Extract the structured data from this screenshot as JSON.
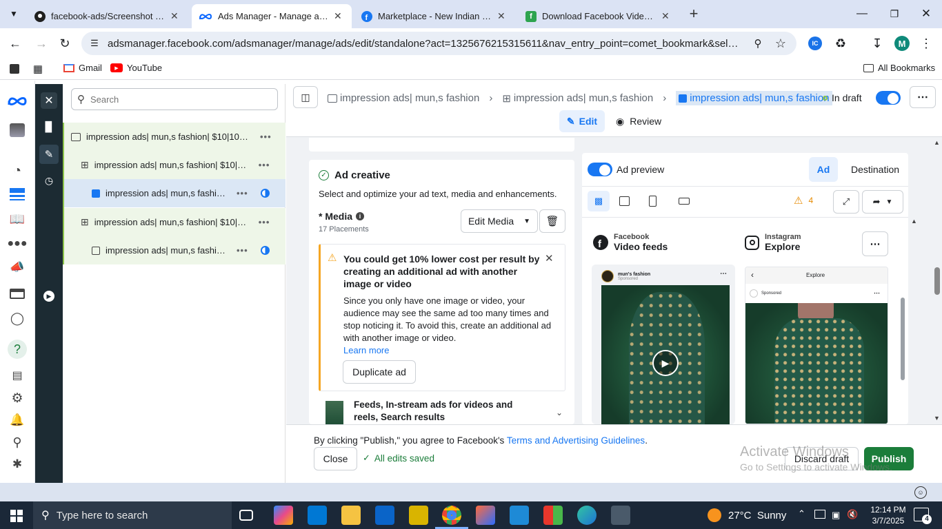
{
  "browser": {
    "tabs": [
      {
        "title": "facebook-ads/Screenshot (10).p",
        "icon": "github-icon"
      },
      {
        "title": "Ads Manager - Manage ads - A",
        "icon": "meta-icon"
      },
      {
        "title": "Marketplace - New Indian Dres",
        "icon": "facebook-icon"
      },
      {
        "title": "Download Facebook Videos On",
        "icon": "fdown-icon"
      }
    ],
    "url": "adsmanager.facebook.com/adsmanager/manage/ads/edit/standalone?act=1325676215315611&nav_entry_point=comet_bookmark&selected_cam...",
    "profile_initial": "M",
    "bookmarks": [
      "Gmail",
      "YouTube"
    ],
    "all_bookmarks": "All Bookmarks"
  },
  "search": {
    "placeholder": "Search"
  },
  "tree": {
    "items": [
      {
        "label": "impression ads| mun,s fashion| $10|10day...",
        "level": 0
      },
      {
        "label": "impression ads| mun,s fashion| $10|10...",
        "level": 1
      },
      {
        "label": "impression ads| mun,s fashion...",
        "level": 2
      },
      {
        "label": "impression ads| mun,s fashion| $10|10...",
        "level": 1
      },
      {
        "label": "impression ads| mun,s fashion...",
        "level": 2
      }
    ]
  },
  "breadcrumb": {
    "items": [
      "impression ads| mun,s fashion",
      "impression ads| mun,s fashion",
      "impression ads| mun,s fashion"
    ],
    "status": "In draft"
  },
  "mode_tabs": {
    "edit": "Edit",
    "review": "Review"
  },
  "creative": {
    "title": "Ad creative",
    "subtitle": "Select and optimize your ad text, media and enhancements.",
    "media_label": "* Media",
    "placements": "17 Placements",
    "edit_media": "Edit Media",
    "alert": {
      "title": "You could get 10% lower cost per result by creating an additional ad with another image or video",
      "body": "Since you only have one image or video, your audience may see the same ad too many times and stop noticing it. To avoid this, create an additional ad with another image or video.",
      "link": "Learn more",
      "button": "Duplicate ad"
    },
    "placement_row": "Feeds, In-stream ads for videos and reels, Search results"
  },
  "preview": {
    "label": "Ad preview",
    "tab_ad": "Ad",
    "tab_destination": "Destination",
    "warning_count": "4",
    "left": {
      "platform": "Facebook",
      "placement": "Video feeds",
      "page_name": "mun's fashion",
      "sponsored": "Sponsored"
    },
    "right": {
      "platform": "Instagram",
      "placement": "Explore",
      "header": "Explore",
      "sponsored": "Sponsored"
    }
  },
  "footer": {
    "consent_prefix": "By clicking \"Publish,\" you agree to Facebook's",
    "consent_link": "Terms and Advertising Guidelines",
    "consent_suffix": ".",
    "close": "Close",
    "saved": "All edits saved",
    "discard": "Discard draft",
    "publish": "Publish",
    "watermark_title": "Activate Windows",
    "watermark_sub": "Go to Settings to activate Windows."
  },
  "taskbar": {
    "search_placeholder": "Type here to search",
    "weather": "27°C  Sunny",
    "time": "12:14 PM",
    "date": "3/7/2025",
    "notifications": "4"
  },
  "colors": {
    "accent": "#1877f2",
    "publish": "#1b7d3a",
    "warning": "#f5a623",
    "dark_rail": "#1c2b33"
  }
}
